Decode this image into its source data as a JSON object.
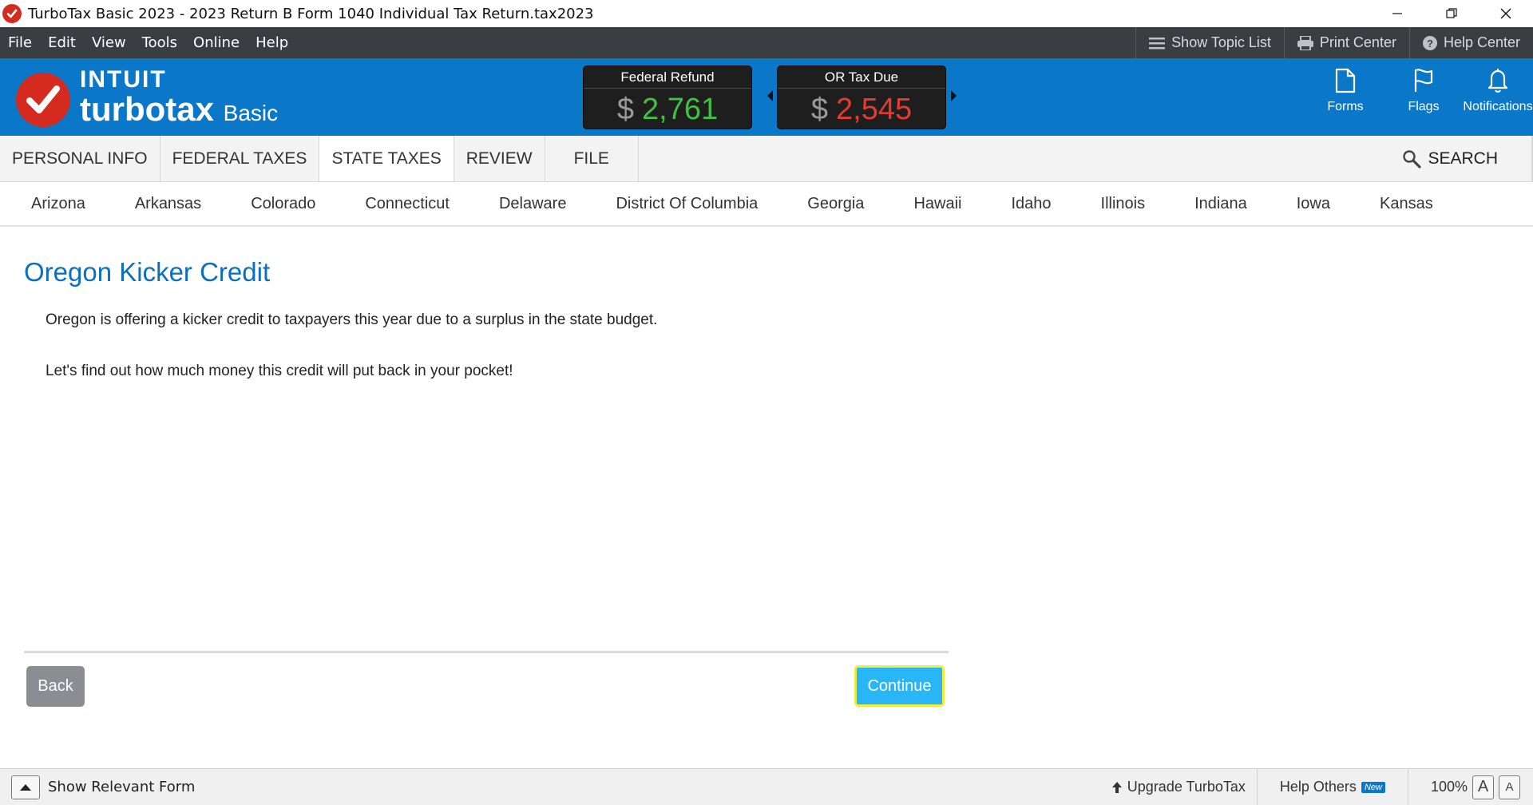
{
  "window": {
    "title": "TurboTax Basic 2023 - 2023 Return B Form 1040  Individual Tax Return.tax2023"
  },
  "menu": {
    "items": [
      "File",
      "Edit",
      "View",
      "Tools",
      "Online",
      "Help"
    ],
    "tools": {
      "topic_list": "Show Topic List",
      "print_center": "Print Center",
      "help_center": "Help Center"
    }
  },
  "header": {
    "logo": {
      "brand": "INTUIT",
      "product": "turbotax",
      "edition": "Basic"
    },
    "federal": {
      "label": "Federal Refund",
      "currency": "$",
      "amount": "2,761",
      "color": "#3fc142"
    },
    "state": {
      "label": "OR Tax Due",
      "currency": "$",
      "amount": "2,545",
      "color": "#e53a2f"
    },
    "icons": {
      "forms": "Forms",
      "flags": "Flags",
      "notifications": "Notifications"
    }
  },
  "tabs": {
    "items": [
      "PERSONAL INFO",
      "FEDERAL TAXES",
      "STATE TAXES",
      "REVIEW",
      "FILE"
    ],
    "active": "STATE TAXES",
    "search": "SEARCH"
  },
  "states": [
    "Arizona",
    "Arkansas",
    "Colorado",
    "Connecticut",
    "Delaware",
    "District Of Columbia",
    "Georgia",
    "Hawaii",
    "Idaho",
    "Illinois",
    "Indiana",
    "Iowa",
    "Kansas"
  ],
  "main": {
    "title": "Oregon Kicker Credit",
    "paragraphs": [
      "Oregon is offering a kicker credit to taxpayers this year due to a surplus in the state budget.",
      "Let's find out how much money this credit will put back in your pocket!"
    ],
    "back": "Back",
    "continue": "Continue"
  },
  "statusbar": {
    "relevant_form": "Show Relevant Form",
    "upgrade": "Upgrade TurboTax",
    "help_others": "Help Others",
    "new_badge": "New",
    "zoom": "100%",
    "font_large": "A",
    "font_small": "A"
  },
  "colors": {
    "brand_blue": "#0a77c9",
    "brand_red": "#d52b1e",
    "menu_dark": "#3a3d42",
    "continue_blue": "#29b6f6"
  }
}
